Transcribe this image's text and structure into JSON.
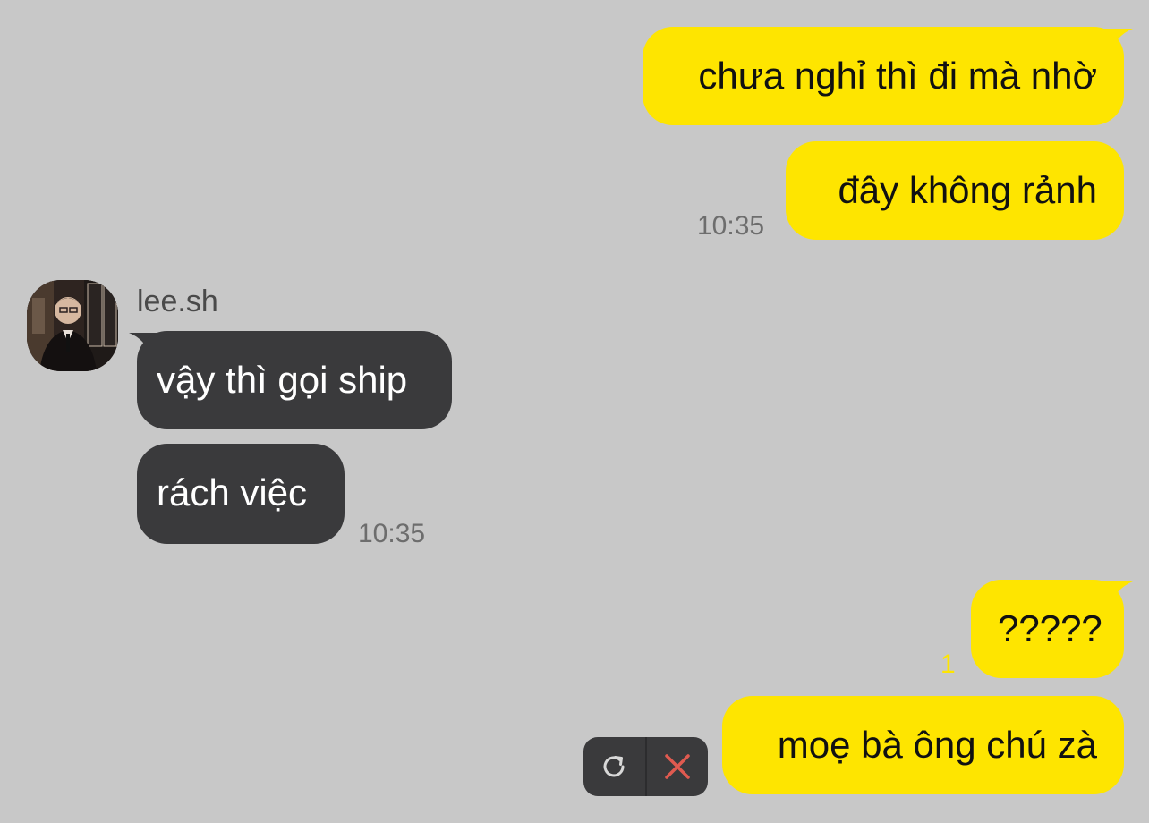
{
  "messages": {
    "m1": {
      "text": "chưa nghỉ thì đi mà nhờ"
    },
    "m2": {
      "text": "đây không rảnh",
      "time": "10:35"
    },
    "m3": {
      "sender": "lee.sh",
      "text": "vậy thì gọi ship"
    },
    "m4": {
      "text": "rách việc",
      "time": "10:35"
    },
    "m5": {
      "text": "?????",
      "unread_count": "1"
    },
    "m6": {
      "text": "moẹ bà ông chú zà"
    }
  },
  "failed_actions": {
    "retry_icon": "retry-icon",
    "delete_icon": "close-icon"
  },
  "colors": {
    "background": "#c8c8c8",
    "outgoing_bubble": "#fee500",
    "incoming_bubble": "#3a3a3c",
    "unread_count": "#fee500",
    "delete_x": "#e05a50"
  }
}
